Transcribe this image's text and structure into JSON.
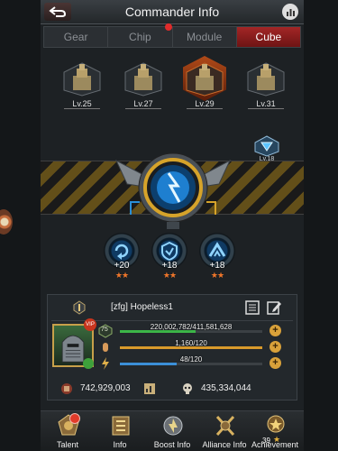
{
  "header": {
    "title": "Commander Info"
  },
  "tabs": [
    {
      "label": "Gear",
      "active": false,
      "has_badge": false
    },
    {
      "label": "Chip",
      "active": false,
      "has_badge": true
    },
    {
      "label": "Module",
      "active": false,
      "has_badge": false
    },
    {
      "label": "Cube",
      "active": true,
      "has_badge": false
    }
  ],
  "cubes": [
    {
      "level": "Lv.25",
      "selected": false,
      "icon": "fortress-emblem-icon"
    },
    {
      "level": "Lv.27",
      "selected": false,
      "icon": "fortress-emblem-icon"
    },
    {
      "level": "Lv.29",
      "selected": true,
      "icon": "fortress-emblem-icon"
    },
    {
      "level": "Lv.31",
      "selected": false,
      "icon": "fortress-emblem-icon"
    }
  ],
  "cube_core": {
    "icon": "lightning-cube-core-icon",
    "badge_level": "Lv.18"
  },
  "skills": [
    {
      "value": "+20",
      "stars": "★★",
      "icon": "recycle-skill-icon"
    },
    {
      "value": "+18",
      "stars": "★★",
      "icon": "shield-skill-icon"
    },
    {
      "value": "+18",
      "stars": "★★",
      "icon": "chevron-skill-icon"
    }
  ],
  "commander": {
    "name": "[zfg]  Hopeless1",
    "vip_label": "VIP",
    "level_badge": "75",
    "stats": [
      {
        "icon": "experience-icon",
        "text": "220,002,782/411,581,628",
        "fill": 0.53,
        "color": "#3cb648"
      },
      {
        "icon": "bullet-icon",
        "text": "1,160/120",
        "fill": 1.0,
        "color": "#d99a2b"
      },
      {
        "icon": "stamina-icon",
        "text": "48/120",
        "fill": 0.4,
        "color": "#3b8fd8"
      }
    ],
    "power": "742,929,003",
    "kills": "435,334,044"
  },
  "nav": [
    {
      "label": "Talent",
      "icon": "talent-icon",
      "badge": true
    },
    {
      "label": "Info",
      "icon": "info-icon",
      "badge": false
    },
    {
      "label": "Boost Info",
      "icon": "boost-icon",
      "badge": false
    },
    {
      "label": "Alliance Info",
      "icon": "alliance-icon",
      "badge": false
    },
    {
      "label": "Achievement",
      "icon": "achievement-icon",
      "badge": false,
      "count": "39"
    }
  ],
  "colors": {
    "accent_red": "#a32626",
    "gold": "#d9a13a",
    "panel": "#1d2124"
  }
}
